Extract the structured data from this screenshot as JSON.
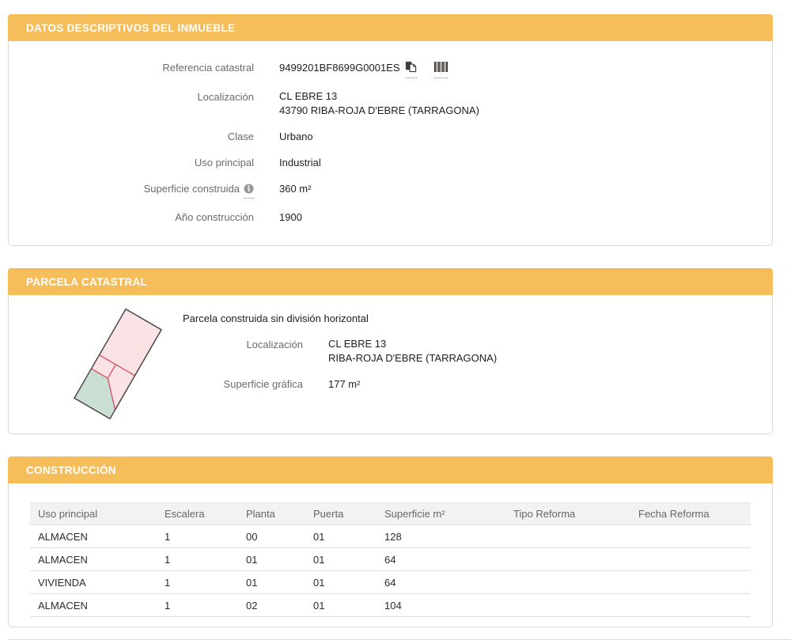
{
  "colors": {
    "section_header_bg": "#F5BE5B",
    "section_header_text": "#FFFFFF",
    "label_text": "#6B6B6B",
    "value_text": "#1E1E1E",
    "panel_border": "#DDD9D4",
    "table_header_bg": "#F2F2F1",
    "table_row_border": "#DDDDDD",
    "parcel_fill_pink": "#FBE3E5",
    "parcel_fill_green": "#C9DFD2",
    "parcel_line_red": "#D6566A",
    "parcel_outline": "#4D4D4D"
  },
  "sections": {
    "inmueble": {
      "title": "DATOS DESCRIPTIVOS DEL INMUEBLE",
      "referencia": {
        "label": "Referencia catastral",
        "value": "9499201BF8699G0001ES"
      },
      "localizacion": {
        "label": "Localización",
        "line1": "CL EBRE 13",
        "line2": "43790 RIBA-ROJA D'EBRE (TARRAGONA)"
      },
      "clase": {
        "label": "Clase",
        "value": "Urbano"
      },
      "uso": {
        "label": "Uso principal",
        "value": "Industrial"
      },
      "superficie": {
        "label": "Superficie construida",
        "value": "360 m²"
      },
      "anio": {
        "label": "Año construcción",
        "value": "1900"
      }
    },
    "parcela": {
      "title": "PARCELA CATASTRAL",
      "intro": "Parcela construida sin división horizontal",
      "localizacion": {
        "label": "Localización",
        "line1": "CL EBRE 13",
        "line2": "RIBA-ROJA D'EBRE (TARRAGONA)"
      },
      "superficie": {
        "label": "Superficie gráfica",
        "value": "177 m²"
      }
    },
    "construccion": {
      "title": "CONSTRUCCIÓN",
      "table": {
        "headers": [
          "Uso principal",
          "Escalera",
          "Planta",
          "Puerta",
          "Superficie m²",
          "Tipo Reforma",
          "Fecha Reforma"
        ],
        "rows": [
          [
            "ALMACEN",
            "1",
            "00",
            "01",
            "128",
            "",
            ""
          ],
          [
            "ALMACEN",
            "1",
            "01",
            "01",
            "64",
            "",
            ""
          ],
          [
            "VIVIENDA",
            "1",
            "01",
            "01",
            "64",
            "",
            ""
          ],
          [
            "ALMACEN",
            "1",
            "02",
            "01",
            "104",
            "",
            ""
          ]
        ]
      }
    }
  },
  "icons": {
    "copy": "copy-to-clipboard-icon",
    "barcode": "barcode-icon",
    "info": "info-icon"
  }
}
